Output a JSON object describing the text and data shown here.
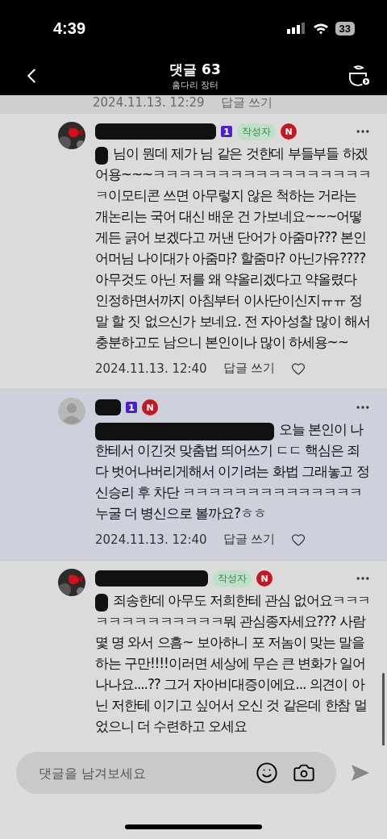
{
  "status_bar": {
    "time": "4:39",
    "battery": "33"
  },
  "header": {
    "title": "댓글 63",
    "subtitle": "홈다리 장터"
  },
  "previous_comment": {
    "date": "2024.11.13. 12:29",
    "reply": "답글 쓰기"
  },
  "comments": [
    {
      "avatar": {
        "kind": "picture"
      },
      "name_redacted": true,
      "badges": [
        {
          "kind": "level",
          "text": "1"
        },
        {
          "kind": "author",
          "text": "작성자"
        },
        {
          "kind": "new",
          "text": "N"
        }
      ],
      "highlighted": false,
      "prefix_redacted": true,
      "mention": false,
      "text": "님이 뭔데 제가 님 같은 것한데 부들부들 하겠어용~~~ㅋㅋㅋㅋㅋㅋㅋㅋㅋㅋㅋㅋㅋㅋㅋㅋㅋㅋ이모티콘 쓰면 아무렇지 않은 척하는 거라는 개논리는 국어 대신 배운 건 가보네요~~~어떻게든 긁어 보겠다고 꺼낸 단어가 아줌마??? 본인 어머님 나이대가 아줌마? 할줌마? 아닌가유???? 아무것도 아닌 저를 왜 약올리겠다고 약올렸다 인정하면서까지  아침부터 이사단이신지ㅠㅠ 정말 할 짓 없으신가 보네요. 전 자아성찰 많이 해서 충분하고도 남으니 본인이나 많이 하세용~~",
      "date": "2024.11.13. 12:40",
      "reply": "답글 쓰기"
    },
    {
      "avatar": {
        "kind": "default"
      },
      "name_redacted": true,
      "badges": [
        {
          "kind": "level",
          "text": "1"
        },
        {
          "kind": "new",
          "text": "N"
        }
      ],
      "highlighted": true,
      "prefix_redacted": true,
      "mention": true,
      "text": "오늘 본인이 나한테서 이긴것 맞춤법 띄어쓰기 ㄷㄷ 핵심은 죄다 벗어나버리게해서 이기려는 화법 그래놓고 정신승리 후 차단 ㅋㅋㅋㅋㅋㅋㅋㅋㅋㅋㅋㅋㅋㅋ 누굴 더 병신으로 볼까요?ㅎㅎ",
      "date": "2024.11.13. 12:40",
      "reply": "답글 쓰기"
    },
    {
      "avatar": {
        "kind": "picture"
      },
      "name_redacted": true,
      "badges": [
        {
          "kind": "author",
          "text": "작성자"
        },
        {
          "kind": "new",
          "text": "N"
        }
      ],
      "highlighted": false,
      "prefix_redacted": true,
      "mention": false,
      "text": "죄송한데 아무도 저희한테 관심 없어요ㅋㅋㅋㅋㅋㅋㅋㅋㅋㅋㅋㅋㅋ뭐 관심종자세요??? 사람 몇 명 와서 으흠~ 보아하니 포 저놈이 맞는 말을 하는 구만!!!!이러면 세상에 무슨 큰 변화가 일어나나요....?? 그거 자아비대증이에요... 의견이 아닌 저한테 이기고 싶어서 오신 것 같은데 한참 멀었으니 더 수련하고 오세요"
    }
  ],
  "input": {
    "placeholder": "댓글을 남겨보세요"
  }
}
